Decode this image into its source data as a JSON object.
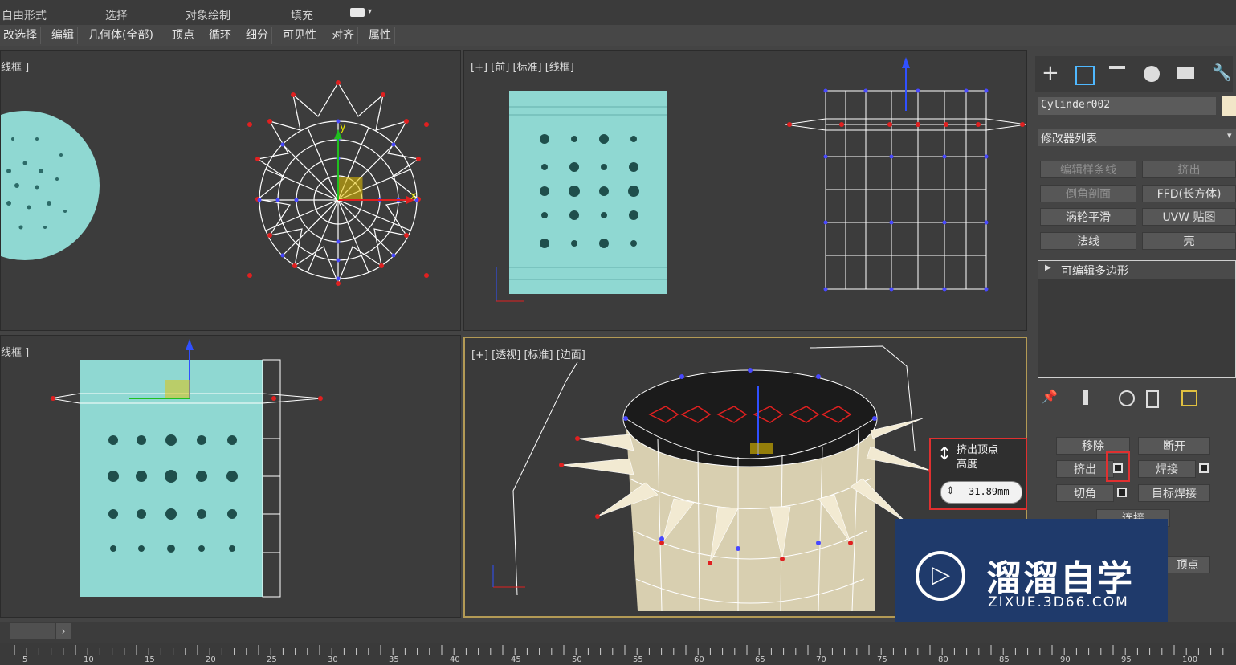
{
  "ribbon": {
    "tabs": [
      "自由形式",
      "选择",
      "对象绘制",
      "填充"
    ],
    "sub_buttons": [
      "改选择",
      "编辑",
      "几何体(全部)",
      "顶点",
      "循环",
      "细分",
      "可见性",
      "对齐",
      "属性"
    ]
  },
  "viewports": {
    "top_left": {
      "label": "线框 ]"
    },
    "top_right": {
      "label": "[+] [前] [标准] [线框]"
    },
    "bottom_left": {
      "label": "线框 ]"
    },
    "perspective": {
      "label": "[+] [透视] [标准] [边面]"
    }
  },
  "axes": {
    "x": "x",
    "y": "y",
    "z": "z"
  },
  "caddy": {
    "title_line1": "挤出顶点",
    "title_line2": "高度",
    "value": "31.89mm"
  },
  "command_panel": {
    "tab_icons": [
      "create-icon",
      "modify-icon",
      "hierarchy-icon",
      "motion-icon",
      "display-icon",
      "utilities-icon"
    ],
    "object_name": "Cylinder002",
    "object_color": "#f2e6c8",
    "modifier_list_label": "修改器列表",
    "modifier_buttons": [
      "编辑样条线",
      "挤出",
      "倒角剖面",
      "FFD(长方体)",
      "涡轮平滑",
      "UVW 贴图",
      "法线",
      "壳"
    ],
    "stack_item": "可编辑多边形",
    "edit_buttons": {
      "remove": "移除",
      "break": "断开",
      "extrude": "挤出",
      "weld": "焊接",
      "chamfer": "切角",
      "target_weld": "目标焊接",
      "connect": "连接",
      "vertex_partial": "顶点"
    }
  },
  "timeline": {
    "ticks": [
      "5",
      "10",
      "15",
      "20",
      "25",
      "30",
      "35",
      "40",
      "45",
      "50",
      "55",
      "60",
      "65",
      "70",
      "75",
      "80",
      "85",
      "90",
      "95",
      "100"
    ]
  },
  "watermark": {
    "brand": "溜溜自学",
    "url": "ZIXUE.3D66.COM"
  },
  "colors": {
    "mesh_cyan": "#8fd8d2",
    "vertex_red": "#e02020",
    "vertex_blue": "#4040ff",
    "highlight_red": "#e03030",
    "viewport_active": "#b39a55"
  }
}
